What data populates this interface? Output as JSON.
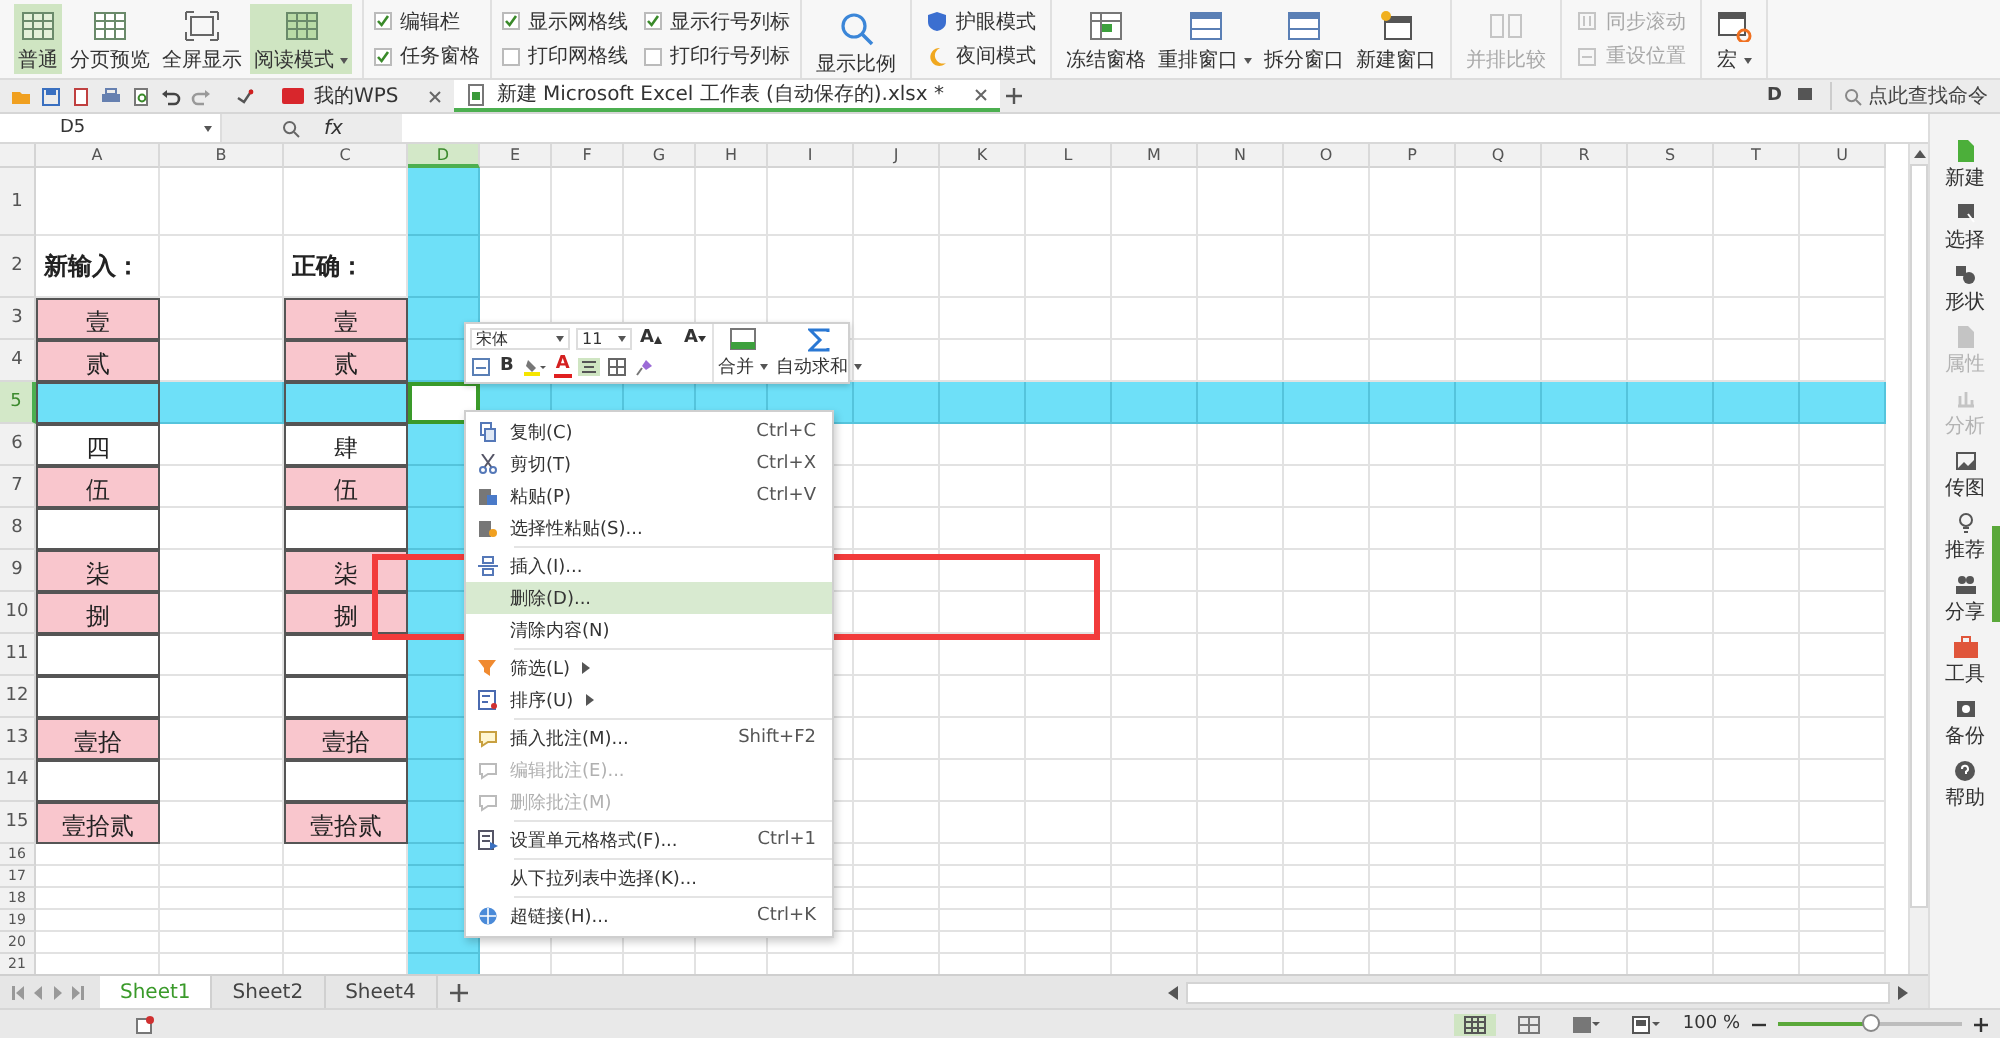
{
  "ribbon": {
    "groups": [
      {
        "kind": "large",
        "items": [
          {
            "label": "普通",
            "selected": true,
            "dropdown": false,
            "disabled": false
          },
          {
            "label": "分页预览",
            "selected": false,
            "dropdown": false,
            "disabled": false
          },
          {
            "label": "全屏显示",
            "selected": false,
            "dropdown": false,
            "disabled": false
          },
          {
            "label": "阅读模式",
            "selected": true,
            "dropdown": true,
            "disabled": false
          }
        ]
      },
      {
        "kind": "checks",
        "items": [
          {
            "label": "编辑栏",
            "checked": true
          },
          {
            "label": "任务窗格",
            "checked": true
          }
        ]
      },
      {
        "kind": "checks",
        "items": [
          {
            "label": "显示网格线",
            "checked": true
          },
          {
            "label": "打印网格线",
            "checked": false
          },
          {
            "label": "显示行号列标",
            "checked": true
          },
          {
            "label": "打印行号列标",
            "checked": false
          }
        ]
      },
      {
        "kind": "large",
        "items": [
          {
            "label": "显示比例",
            "selected": false,
            "dropdown": false,
            "disabled": false
          }
        ]
      },
      {
        "kind": "small",
        "items": [
          {
            "label": "护眼模式",
            "disabled": false
          },
          {
            "label": "夜间模式",
            "disabled": false
          }
        ]
      },
      {
        "kind": "large",
        "items": [
          {
            "label": "冻结窗格",
            "selected": false,
            "dropdown": false,
            "disabled": false
          },
          {
            "label": "重排窗口",
            "selected": false,
            "dropdown": true,
            "disabled": false
          },
          {
            "label": "拆分窗口",
            "selected": false,
            "dropdown": false,
            "disabled": false
          },
          {
            "label": "新建窗口",
            "selected": false,
            "dropdown": false,
            "disabled": false
          }
        ]
      },
      {
        "kind": "large",
        "items": [
          {
            "label": "并排比较",
            "selected": false,
            "dropdown": false,
            "disabled": true
          }
        ]
      },
      {
        "kind": "small",
        "items": [
          {
            "label": "同步滚动",
            "disabled": true
          },
          {
            "label": "重设位置",
            "disabled": true
          }
        ]
      },
      {
        "kind": "large",
        "items": [
          {
            "label": "宏",
            "selected": false,
            "dropdown": true,
            "disabled": false
          }
        ]
      }
    ]
  },
  "doc_tabs": [
    {
      "label": "我的WPS",
      "kind": "home",
      "selected": false
    },
    {
      "label": "新建 Microsoft Excel 工作表 (自动保存的).xlsx *",
      "kind": "sheet",
      "selected": true
    }
  ],
  "top_right": {
    "letter": "D",
    "search_placeholder": "点此查找命令"
  },
  "formula_bar": {
    "name_box": "D5",
    "fx": "fx"
  },
  "columns": [
    {
      "label": "A",
      "selected": false
    },
    {
      "label": "B",
      "selected": false
    },
    {
      "label": "C",
      "selected": false
    },
    {
      "label": "D",
      "selected": true
    },
    {
      "label": "E",
      "selected": false
    },
    {
      "label": "F",
      "selected": false
    },
    {
      "label": "G",
      "selected": false
    },
    {
      "label": "H",
      "selected": false
    },
    {
      "label": "I",
      "selected": false
    },
    {
      "label": "J",
      "selected": false
    },
    {
      "label": "K",
      "selected": false
    },
    {
      "label": "L",
      "selected": false
    },
    {
      "label": "M",
      "selected": false
    },
    {
      "label": "N",
      "selected": false
    },
    {
      "label": "O",
      "selected": false
    },
    {
      "label": "P",
      "selected": false
    },
    {
      "label": "Q",
      "selected": false
    },
    {
      "label": "R",
      "selected": false
    },
    {
      "label": "S",
      "selected": false
    },
    {
      "label": "T",
      "selected": false
    },
    {
      "label": "U",
      "selected": false
    }
  ],
  "rows": [
    {
      "label": "1",
      "selected": false
    },
    {
      "label": "2",
      "selected": false,
      "cells": [
        {
          "text": "新输入：",
          "kind": "heading",
          "highlighted": false,
          "bordered": false
        },
        {
          "highlighted": false,
          "bordered": false
        },
        {
          "text": "正确：",
          "kind": "heading",
          "highlighted": false,
          "bordered": false
        }
      ]
    },
    {
      "label": "3",
      "selected": false,
      "cells": [
        {
          "text": "壹",
          "kind": "value",
          "highlighted": true,
          "bordered": true
        },
        {
          "highlighted": false,
          "bordered": false
        },
        {
          "text": "壹",
          "kind": "value",
          "highlighted": true,
          "bordered": true
        }
      ]
    },
    {
      "label": "4",
      "selected": false,
      "cells": [
        {
          "text": "贰",
          "kind": "value",
          "highlighted": true,
          "bordered": true
        },
        {
          "highlighted": false,
          "bordered": false
        },
        {
          "text": "贰",
          "kind": "value",
          "highlighted": true,
          "bordered": true
        }
      ]
    },
    {
      "label": "5",
      "selected": true,
      "cells": [
        {
          "bordered": true
        },
        {
          "bordered": false
        },
        {
          "bordered": true
        }
      ]
    },
    {
      "label": "6",
      "selected": false,
      "cells": [
        {
          "text": "四",
          "kind": "value",
          "highlighted": false,
          "bordered": true
        },
        {
          "highlighted": false,
          "bordered": false
        },
        {
          "text": "肆",
          "kind": "value",
          "highlighted": false,
          "bordered": true
        }
      ]
    },
    {
      "label": "7",
      "selected": false,
      "cells": [
        {
          "text": "伍",
          "kind": "value",
          "highlighted": true,
          "bordered": true
        },
        {
          "highlighted": false,
          "bordered": false
        },
        {
          "text": "伍",
          "kind": "value",
          "highlighted": true,
          "bordered": true
        }
      ]
    },
    {
      "label": "8",
      "selected": false,
      "cells": [
        {
          "highlighted": false,
          "bordered": true
        },
        {
          "highlighted": false,
          "bordered": false
        },
        {
          "highlighted": false,
          "bordered": true
        }
      ]
    },
    {
      "label": "9",
      "selected": false,
      "cells": [
        {
          "text": "柒",
          "kind": "value",
          "highlighted": true,
          "bordered": true
        },
        {
          "highlighted": false,
          "bordered": false
        },
        {
          "text": "柒",
          "kind": "value",
          "highlighted": true,
          "bordered": true
        }
      ]
    },
    {
      "label": "10",
      "selected": false,
      "cells": [
        {
          "text": "捌",
          "kind": "value",
          "highlighted": true,
          "bordered": true
        },
        {
          "highlighted": false,
          "bordered": false
        },
        {
          "text": "捌",
          "kind": "value",
          "highlighted": true,
          "bordered": true
        }
      ]
    },
    {
      "label": "11",
      "selected": false,
      "cells": [
        {
          "highlighted": false,
          "bordered": true
        },
        {
          "highlighted": false,
          "bordered": false
        },
        {
          "highlighted": false,
          "bordered": true
        }
      ]
    },
    {
      "label": "12",
      "selected": false,
      "cells": [
        {
          "highlighted": false,
          "bordered": true
        },
        {
          "highlighted": false,
          "bordered": false
        },
        {
          "highlighted": false,
          "bordered": true
        }
      ]
    },
    {
      "label": "13",
      "selected": false,
      "cells": [
        {
          "text": "壹拾",
          "kind": "value",
          "highlighted": true,
          "bordered": true
        },
        {
          "highlighted": false,
          "bordered": false
        },
        {
          "text": "壹拾",
          "kind": "value",
          "highlighted": true,
          "bordered": true
        }
      ]
    },
    {
      "label": "14",
      "selected": false,
      "cells": [
        {
          "highlighted": false,
          "bordered": true
        },
        {
          "highlighted": false,
          "bordered": false
        },
        {
          "highlighted": false,
          "bordered": true
        }
      ]
    },
    {
      "label": "15",
      "selected": false,
      "cells": [
        {
          "text": "壹拾贰",
          "kind": "value",
          "highlighted": true,
          "bordered": true
        },
        {
          "highlighted": false,
          "bordered": false
        },
        {
          "text": "壹拾贰",
          "kind": "value",
          "highlighted": true,
          "bordered": true
        }
      ]
    },
    {
      "label": "16",
      "selected": false
    },
    {
      "label": "17",
      "selected": false
    },
    {
      "label": "18",
      "selected": false
    },
    {
      "label": "19",
      "selected": false
    },
    {
      "label": "20",
      "selected": false
    },
    {
      "label": "21",
      "selected": false
    }
  ],
  "mini_toolbar": {
    "font": "宋体",
    "size": "11",
    "grow": "A",
    "shrink": "A",
    "bold": "B",
    "font_color": "A",
    "merge": "合并",
    "autosum": "自动求和"
  },
  "context_menu": {
    "groups": [
      [
        {
          "label": "复制(C)",
          "shortcut": "Ctrl+C",
          "kind": "copy",
          "selected": false,
          "disabled": false,
          "submenu": false
        },
        {
          "label": "剪切(T)",
          "shortcut": "Ctrl+X",
          "kind": "cut",
          "selected": false,
          "disabled": false,
          "submenu": false
        },
        {
          "label": "粘贴(P)",
          "shortcut": "Ctrl+V",
          "kind": "paste",
          "selected": false,
          "disabled": false,
          "submenu": false
        },
        {
          "label": "选择性粘贴(S)...",
          "kind": "paste-special",
          "selected": false,
          "disabled": false,
          "submenu": false
        }
      ],
      [
        {
          "label": "插入(I)...",
          "kind": "insert",
          "selected": false,
          "disabled": false,
          "submenu": false
        },
        {
          "label": "删除(D)...",
          "kind": "plain",
          "selected": true,
          "disabled": false,
          "submenu": false
        },
        {
          "label": "清除内容(N)",
          "kind": "plain",
          "selected": false,
          "disabled": false,
          "submenu": false
        }
      ],
      [
        {
          "label": "筛选(L)",
          "kind": "filter",
          "selected": false,
          "disabled": false,
          "submenu": true
        },
        {
          "label": "排序(U)",
          "kind": "sort",
          "selected": false,
          "disabled": false,
          "submenu": true
        }
      ],
      [
        {
          "label": "插入批注(M)...",
          "shortcut": "Shift+F2",
          "kind": "note",
          "selected": false,
          "disabled": false,
          "submenu": false
        },
        {
          "label": "编辑批注(E)...",
          "kind": "note",
          "selected": false,
          "disabled": true,
          "submenu": false
        },
        {
          "label": "删除批注(M)",
          "kind": "note",
          "selected": false,
          "disabled": true,
          "submenu": false
        }
      ],
      [
        {
          "label": "设置单元格格式(F)...",
          "shortcut": "Ctrl+1",
          "kind": "format",
          "selected": false,
          "disabled": false,
          "submenu": false
        }
      ],
      [
        {
          "label": "从下拉列表中选择(K)...",
          "kind": "plain",
          "selected": false,
          "disabled": false,
          "submenu": false
        }
      ],
      [
        {
          "label": "超链接(H)...",
          "shortcut": "Ctrl+K",
          "kind": "link",
          "selected": false,
          "disabled": false,
          "submenu": false
        }
      ]
    ]
  },
  "sidebar": [
    {
      "label": "新建",
      "disabled": false
    },
    {
      "label": "选择",
      "disabled": false
    },
    {
      "label": "形状",
      "disabled": false
    },
    {
      "label": "属性",
      "disabled": true
    },
    {
      "label": "分析",
      "disabled": true
    },
    {
      "label": "传图",
      "disabled": false
    },
    {
      "label": "推荐",
      "disabled": false
    },
    {
      "label": "分享",
      "disabled": false
    },
    {
      "label": "工具",
      "disabled": false
    },
    {
      "label": "备份",
      "disabled": false
    },
    {
      "label": "帮助",
      "disabled": false
    }
  ],
  "sheet_tabs": [
    {
      "label": "Sheet1",
      "selected": true
    },
    {
      "label": "Sheet2",
      "selected": false
    },
    {
      "label": "Sheet4",
      "selected": false
    }
  ],
  "status_bar": {
    "zoom": "100 %",
    "level": 0.5
  }
}
